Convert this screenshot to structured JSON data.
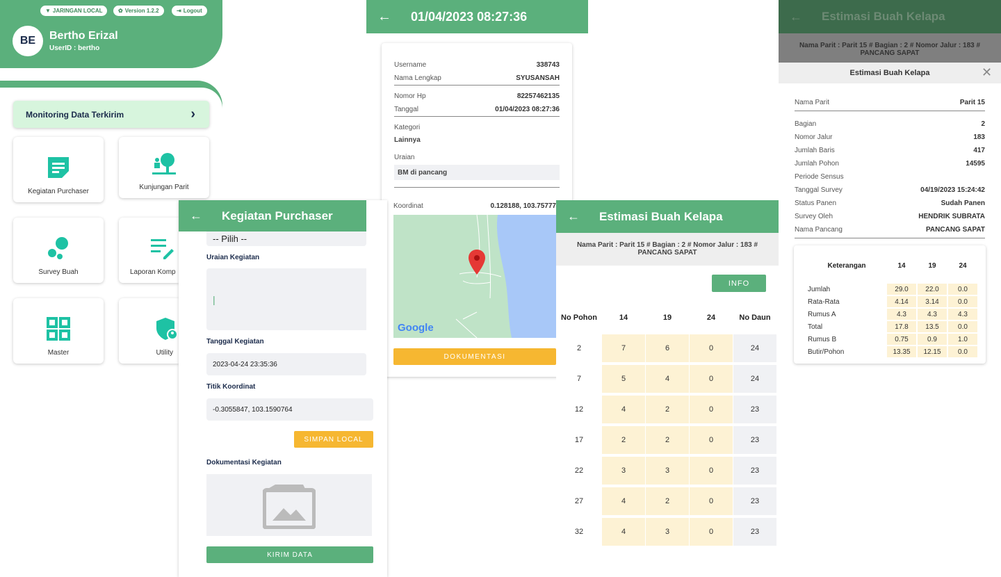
{
  "home": {
    "pills": {
      "network": "JARINGAN LOCAL",
      "version": "Version 1.2.2",
      "logout": "Logout"
    },
    "avatar": "BE",
    "name": "Bertho Erizal",
    "userid": "UserID : bertho",
    "monitoring": "Monitoring Data Terkirim",
    "tiles": {
      "kegiatan": "Kegiatan Purchaser",
      "kunjungan": "Kunjungan Parit",
      "survey": "Survey Buah",
      "laporan": "Laporan Komp",
      "master": "Master",
      "utility": "Utility"
    }
  },
  "detail": {
    "title": "01/04/2023 08:27:36",
    "username_label": "Username",
    "username": "338743",
    "nama_label": "Nama Lengkap",
    "nama": "SYUSANSAH",
    "hp_label": "Nomor Hp",
    "hp": "82257462135",
    "tanggal_label": "Tanggal",
    "tanggal": "01/04/2023 08:27:36",
    "kategori_label": "Kategori",
    "kategori": "Lainnya",
    "uraian_label": "Uraian",
    "uraian": "BM di pancang",
    "koordinat_label": "Koordinat",
    "koordinat": "0.128188, 103.75777",
    "map_logo": "Google",
    "dokumentasi": "DOKUMENTASI"
  },
  "kegiatan": {
    "title": "Kegiatan Purchaser",
    "pilih": "-- Pilih --",
    "uraian_label": "Uraian Kegiatan",
    "tanggal_label": "Tanggal Kegiatan",
    "tanggal": "2023-04-24 23:35:36",
    "titik_label": "Titik Koordinat",
    "titik": "-0.3055847, 103.1590764",
    "simpan": "SIMPAN LOCAL",
    "dok_label": "Dokumentasi Kegiatan",
    "kirim": "KIRIM DATA"
  },
  "estimasi": {
    "title": "Estimasi Buah Kelapa",
    "subtitle": "Nama Parit : Parit 15 # Bagian : 2 # Nomor Jalur : 183 # PANCANG SAPAT",
    "info": "INFO",
    "headers": [
      "No Pohon",
      "14",
      "19",
      "24",
      "No Daun"
    ],
    "rows": [
      [
        "2",
        "7",
        "6",
        "0",
        "24"
      ],
      [
        "7",
        "5",
        "4",
        "0",
        "24"
      ],
      [
        "12",
        "4",
        "2",
        "0",
        "23"
      ],
      [
        "17",
        "2",
        "2",
        "0",
        "23"
      ],
      [
        "22",
        "3",
        "3",
        "0",
        "23"
      ],
      [
        "27",
        "4",
        "2",
        "0",
        "23"
      ],
      [
        "32",
        "4",
        "3",
        "0",
        "23"
      ]
    ]
  },
  "dialog": {
    "bg_title": "Estimasi Buah Kelapa",
    "bg_subtitle": "Nama Parit : Parit 15 # Bagian : 2 # Nomor Jalur : 183 # PANCANG SAPAT",
    "title": "Estimasi Buah Kelapa",
    "fields": [
      {
        "label": "Nama Parit",
        "value": "Parit 15"
      },
      {
        "label": "Bagian",
        "value": "2"
      },
      {
        "label": "Nomor Jalur",
        "value": "183"
      },
      {
        "label": "Jumlah Baris",
        "value": "417"
      },
      {
        "label": "Jumlah Pohon",
        "value": "14595"
      },
      {
        "label": "Periode Sensus",
        "value": ""
      },
      {
        "label": "Tanggal Survey",
        "value": "04/19/2023 15:24:42"
      },
      {
        "label": "Status Panen",
        "value": "Sudah Panen"
      },
      {
        "label": "Survey Oleh",
        "value": "HENDRIK SUBRATA"
      },
      {
        "label": "Nama Pancang",
        "value": "PANCANG SAPAT"
      }
    ],
    "table_headers": [
      "Keterangan",
      "14",
      "19",
      "24"
    ],
    "table_rows": [
      [
        "Jumlah",
        "29.0",
        "22.0",
        "0.0"
      ],
      [
        "Rata-Rata",
        "4.14",
        "3.14",
        "0.0"
      ],
      [
        "Rumus A",
        "4.3",
        "4.3",
        "4.3"
      ],
      [
        "Total",
        "17.8",
        "13.5",
        "0.0"
      ],
      [
        "Rumus B",
        "0.75",
        "0.9",
        "1.0"
      ],
      [
        "Butir/Pohon",
        "13.35",
        "12.15",
        "0.0"
      ]
    ]
  },
  "colors": {
    "green": "#5bb07c",
    "yellow": "#f6b731",
    "cell": "#fdf2d4",
    "teal": "#1ec2a4"
  }
}
